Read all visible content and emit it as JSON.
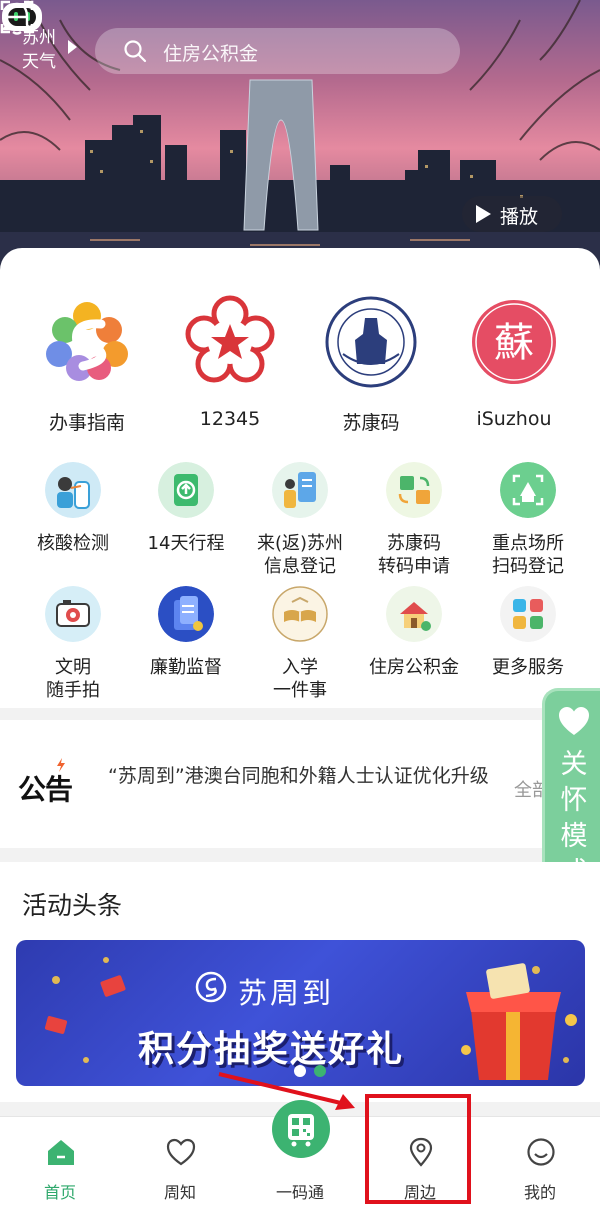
{
  "header": {
    "city": "苏州",
    "weather_label": "天气",
    "search_placeholder": "住房公积金",
    "play_label": "播放"
  },
  "top_services": [
    {
      "label": "办事指南",
      "icon": "colorful-s-logo-icon"
    },
    {
      "label": "12345",
      "icon": "red-star-emblem-icon"
    },
    {
      "label": "苏康码",
      "icon": "health-commission-seal-icon"
    },
    {
      "label": "iSuzhou",
      "icon": "su-character-badge-icon"
    }
  ],
  "services": [
    {
      "label": "核酸检测",
      "icon": "nucleic-test-icon"
    },
    {
      "label": "14天行程",
      "icon": "itinerary-card-icon"
    },
    {
      "label": "来(返)苏州\n信息登记",
      "icon": "registration-icon"
    },
    {
      "label": "苏康码\n转码申请",
      "icon": "code-transfer-icon"
    },
    {
      "label": "重点场所\n扫码登记",
      "icon": "venue-scan-icon"
    },
    {
      "label": "文明\n随手拍",
      "icon": "camera-icon"
    },
    {
      "label": "廉勤监督",
      "icon": "supervision-icon"
    },
    {
      "label": "入学\n一件事",
      "icon": "education-book-icon"
    },
    {
      "label": "住房公积金",
      "icon": "housing-fund-icon"
    },
    {
      "label": "更多服务",
      "icon": "more-services-grid-icon"
    }
  ],
  "notice": {
    "tag": "公告",
    "text": "“苏周到”港澳台同胞和外籍人士认证优化升级",
    "all_label": "全部"
  },
  "care_mode": {
    "label": "关怀模式"
  },
  "activity": {
    "title": "活动头条",
    "banner_brand": "苏周到",
    "banner_promo": "积分抽奖送好礼"
  },
  "tabbar": [
    {
      "label": "首页",
      "icon": "home-icon",
      "active": true
    },
    {
      "label": "周知",
      "icon": "heart-icon",
      "active": false
    },
    {
      "label": "一码通",
      "icon": "qr-bus-icon",
      "active": false
    },
    {
      "label": "周边",
      "icon": "location-pin-icon",
      "active": false
    },
    {
      "label": "我的",
      "icon": "smiley-icon",
      "active": false
    }
  ],
  "colors": {
    "accent_green": "#2ea86b",
    "care_green": "#7ccf9c",
    "annotation_red": "#e0111c",
    "banner_blue": "#3f52d8"
  }
}
